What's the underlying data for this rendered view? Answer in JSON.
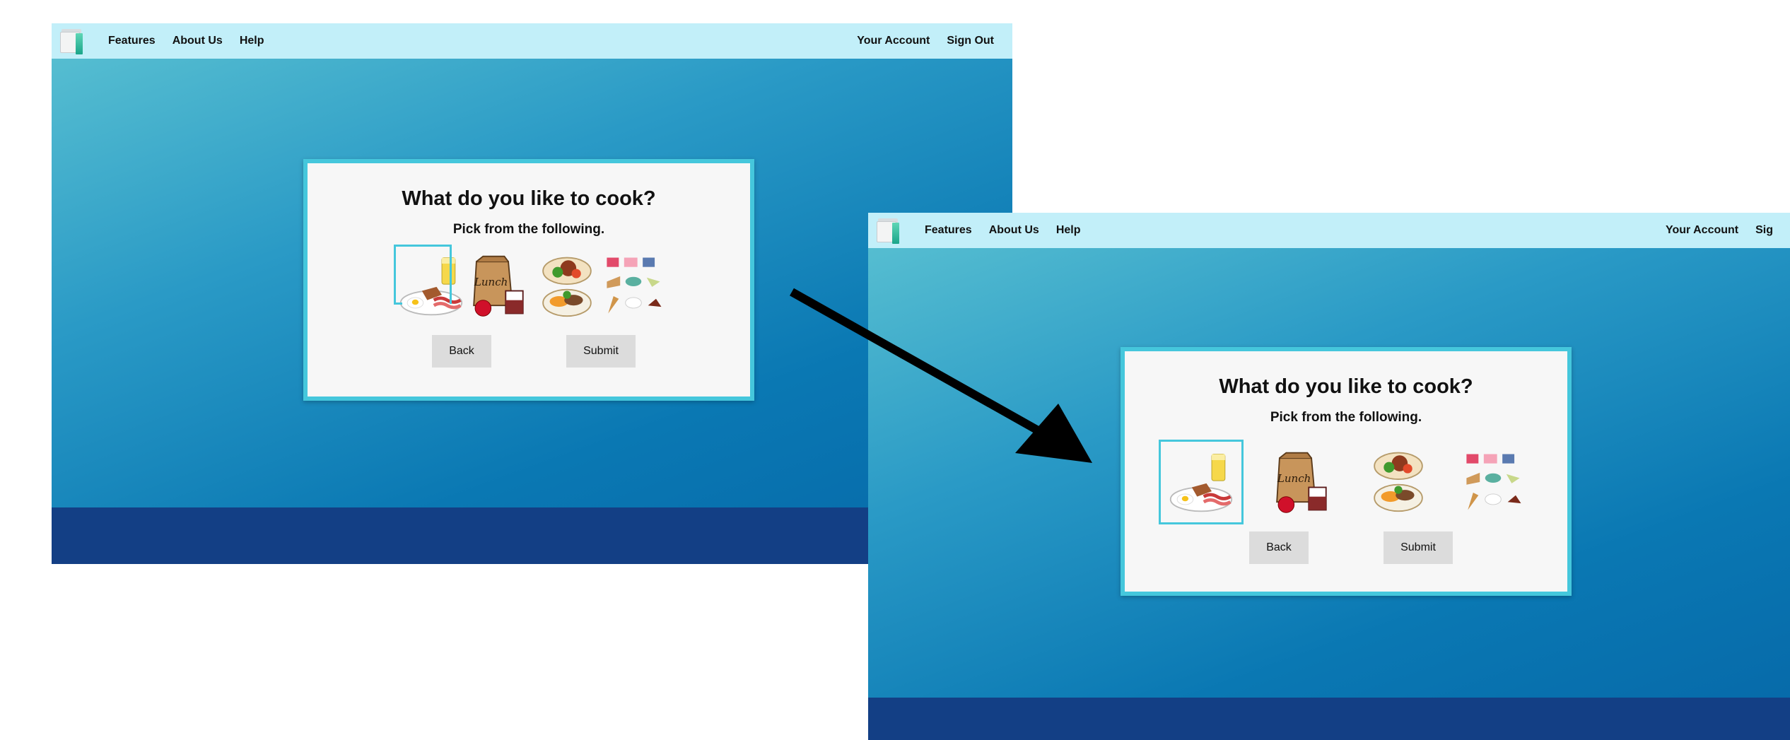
{
  "nav": {
    "features": "Features",
    "about": "About Us",
    "help": "Help",
    "account": "Your Account",
    "signout": "Sign Out",
    "signout_clipped": "Sig"
  },
  "card": {
    "title": "What do you like to cook?",
    "subtitle": "Pick from the following."
  },
  "choices": [
    "breakfast-plate",
    "lunch-bag",
    "dinner-plate",
    "desserts"
  ],
  "buttons": {
    "back": "Back",
    "submit": "Submit"
  },
  "colors": {
    "navbar": "#c2eff9",
    "card_border": "#45c7dc",
    "footer": "#133f85",
    "button": "#dcdcdc"
  }
}
